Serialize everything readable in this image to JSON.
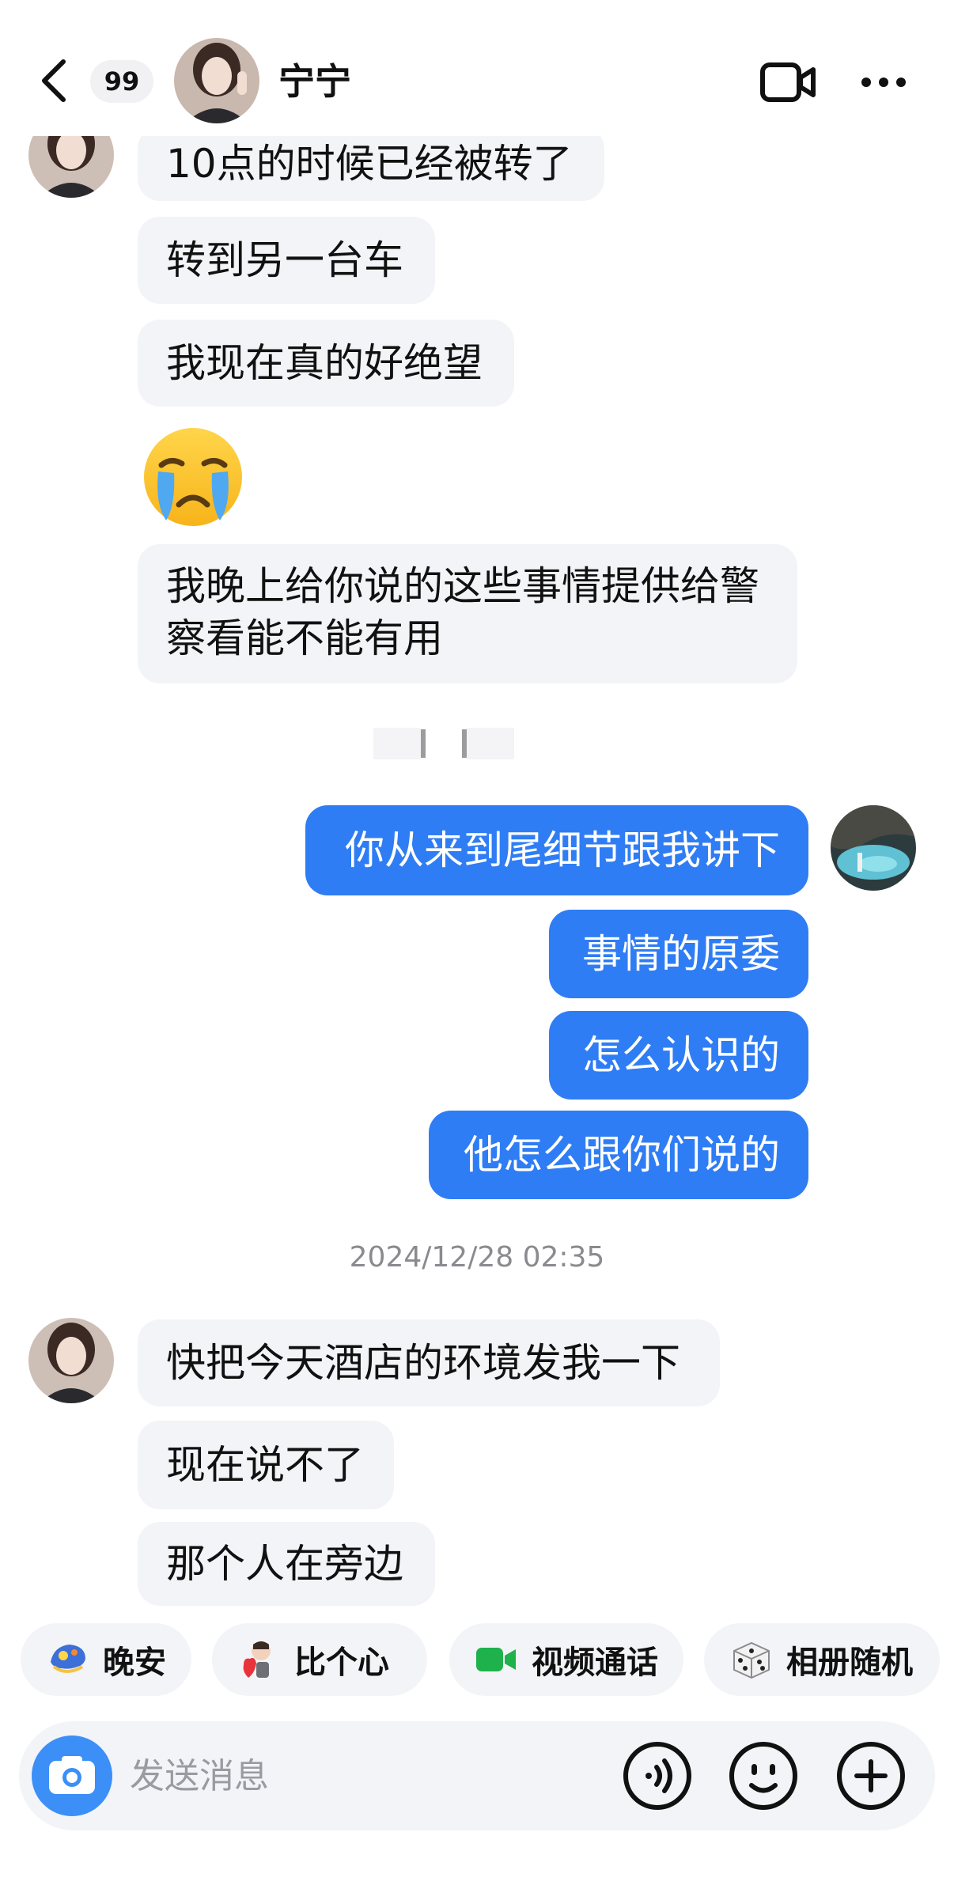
{
  "header": {
    "unread_count": "99",
    "contact_name": "宁宁",
    "back_icon": "chevron-left-icon",
    "call_icon": "video-camera-icon",
    "menu_icon": "more-horizontal-icon"
  },
  "messages": {
    "top": [
      {
        "text": "10点的时候已经被转了"
      },
      {
        "text": "转到另一台车"
      },
      {
        "text": "我现在真的好绝望"
      },
      {
        "emoji": "crying-face"
      },
      {
        "text": "我晚上给你说的这些事情提供给警察看能不能有用"
      }
    ],
    "mine": [
      {
        "text": "你从来到尾细节跟我讲下"
      },
      {
        "text": "事情的原委"
      },
      {
        "text": "怎么认识的"
      },
      {
        "text": "他怎么跟你们说的"
      }
    ],
    "timestamp": "2024/12/28 02:35",
    "bottom": [
      {
        "text": "快把今天酒店的环境发我一下"
      },
      {
        "text": "现在说不了"
      },
      {
        "text": "那个人在旁边"
      }
    ]
  },
  "quick_actions": [
    {
      "label": "晚安",
      "icon": "moon-sticker-icon"
    },
    {
      "label": "比个心",
      "icon": "heart-sticker-icon"
    },
    {
      "label": "视频通话",
      "icon": "video-call-icon"
    },
    {
      "label": "相册随机",
      "icon": "dice-icon"
    }
  ],
  "input": {
    "placeholder": "发送消息"
  },
  "colors": {
    "accent": "#2f7df4",
    "bubble_them": "#f3f4f8",
    "chip_bg": "#f3f4f7"
  }
}
